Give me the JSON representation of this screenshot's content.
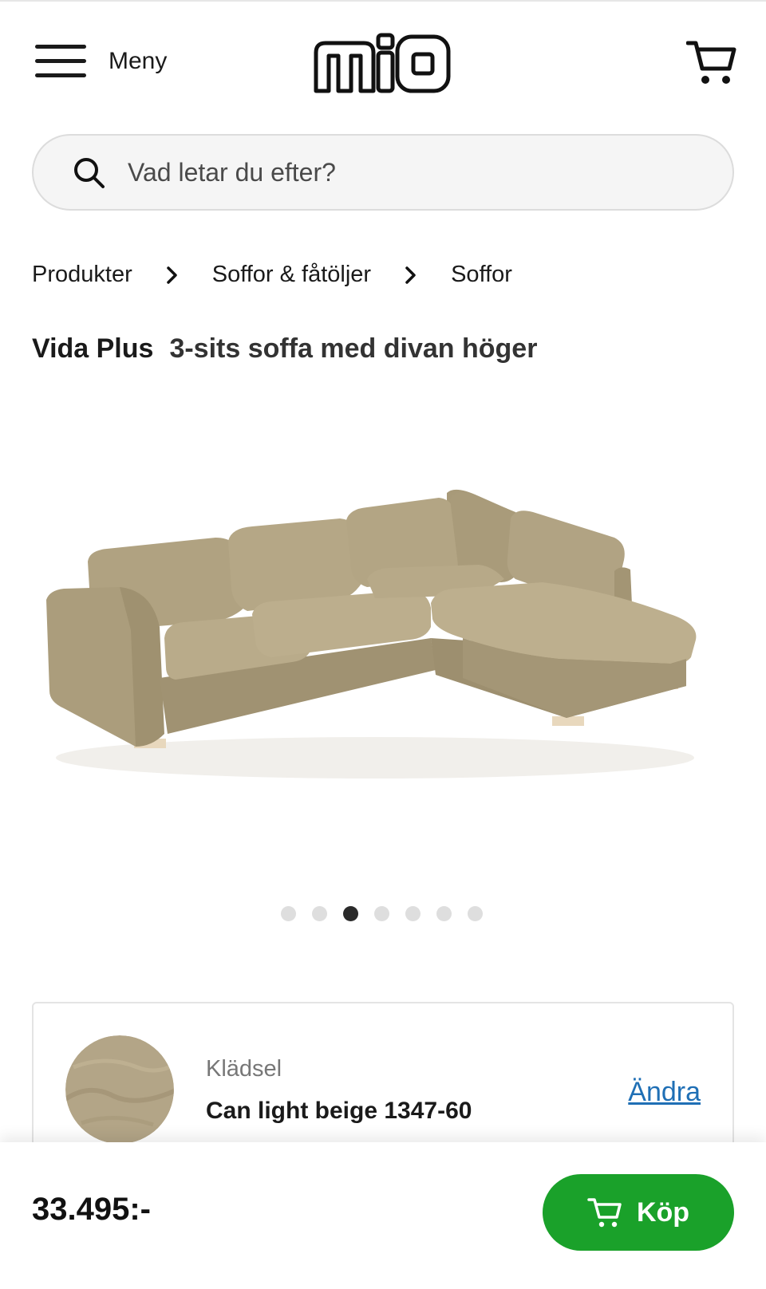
{
  "header": {
    "menu_label": "Meny",
    "logo_text": "miO",
    "icons": {
      "menu": "hamburger-icon",
      "cart": "cart-icon"
    }
  },
  "search": {
    "placeholder": "Vad letar du efter?",
    "icon": "search-icon"
  },
  "breadcrumb": {
    "items": [
      "Produkter",
      "Soffor & fåtöljer",
      "Soffor"
    ],
    "separator_icon": "chevron-right-icon"
  },
  "product": {
    "name": "Vida Plus",
    "subtitle": "3-sits soffa med divan höger",
    "image": "corner-sofa-light-beige"
  },
  "gallery": {
    "image_count": 7,
    "active_index": 2
  },
  "upholstery": {
    "label": "Klädsel",
    "value": "Can light beige 1347-60",
    "change_label": "Ändra",
    "swatch_color": "#b3a587"
  },
  "bottom_bar": {
    "price": "33.495:-",
    "buy_label": "Köp",
    "buy_icon": "cart-icon"
  },
  "colors": {
    "buy_button": "#1aa12a",
    "link": "#1f6fb5",
    "fabric": "#b3a587"
  }
}
